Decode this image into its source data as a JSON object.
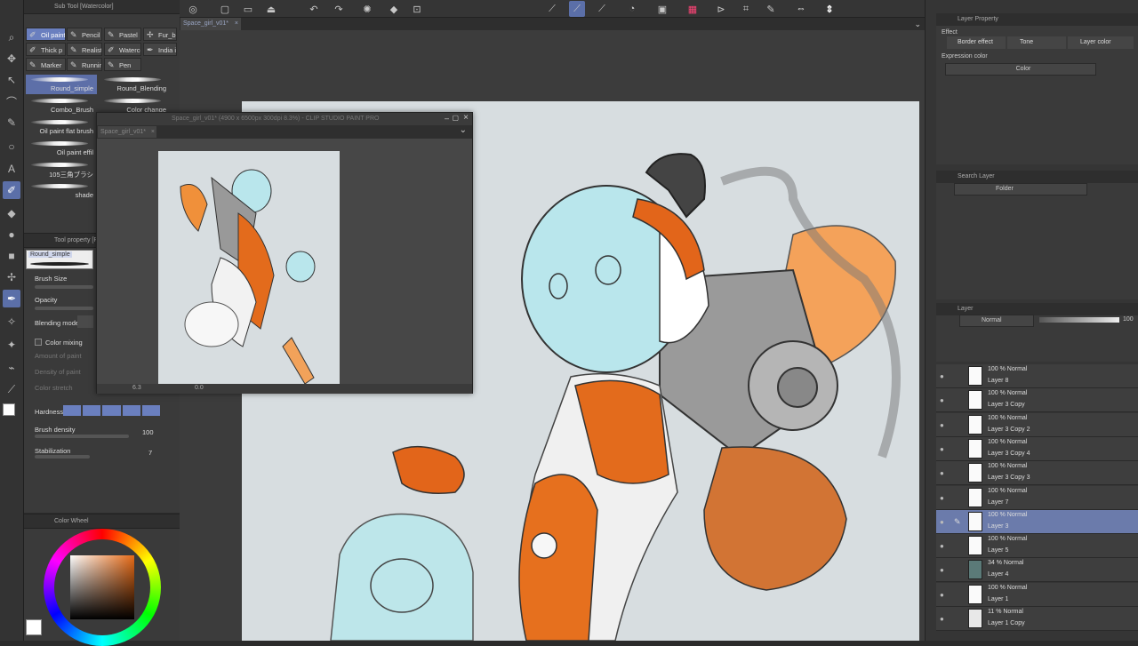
{
  "document_tab": "Space_girl_v01*",
  "subview": {
    "title": "Space_girl_v01* (4900 x 6500px 300dpi 8.3%) - CLIP STUDIO PAINT PRO",
    "tab": "Space_girl_v01*",
    "zoom": "6.3",
    "angle": "0.0"
  },
  "sub_tool": {
    "title": "Sub Tool [Watercolor]",
    "groups": [
      {
        "label": "Oil paint",
        "active": true
      },
      {
        "label": "Pencil"
      },
      {
        "label": "Pastel"
      },
      {
        "label": "Fur_br"
      },
      {
        "label": "Thick p"
      },
      {
        "label": "Realist"
      },
      {
        "label": "Watercolor"
      },
      {
        "label": "India ink"
      },
      {
        "label": "Marker"
      },
      {
        "label": "Running"
      },
      {
        "label": "Pen"
      }
    ],
    "brushes": [
      {
        "label": "Round_simple",
        "active": true
      },
      {
        "label": "Round_Blending"
      },
      {
        "label": "Combo_Brush"
      },
      {
        "label": "Color change"
      },
      {
        "label": "Oil paint flat brush"
      },
      {
        "label": "Oil paint effil"
      },
      {
        "label": "105三角ブラシ"
      },
      {
        "label": "shade"
      }
    ]
  },
  "tool_property": {
    "title": "Tool property [R",
    "preview": "Round_simple",
    "brush_size": "Brush Size",
    "opacity": "Opacity",
    "blending_mode": "Blending mode",
    "color_mixing": "Color mixing",
    "amount_of_paint": "Amount of paint",
    "density_of_paint": "Density of paint",
    "color_stretch": "Color stretch",
    "hardness": "Hardness",
    "brush_density": "Brush density",
    "brush_density_value": "100",
    "stabilization": "Stabilization",
    "stabilization_value": "7"
  },
  "color_wheel": {
    "title": "Color Wheel",
    "main_color": "#ffffff",
    "sub_color": "#000000",
    "square_hue": "#e66a16"
  },
  "layer_property": {
    "title": "Layer Property",
    "effect_label": "Effect",
    "border_effect": "Border effect",
    "tone": "Tone",
    "layer_color": "Layer color",
    "expression_color_label": "Expression color",
    "expression_color_value": "Color"
  },
  "search_layer": {
    "title": "Search Layer",
    "filter": "Folder"
  },
  "layer_panel": {
    "title": "Layer",
    "blend_mode": "Normal",
    "opacity": "100",
    "layers": [
      {
        "mode": "100 % Normal",
        "name": "Layer 8",
        "thumb": "#fafafa"
      },
      {
        "mode": "100 % Normal",
        "name": "Layer 3 Copy",
        "thumb": "#fafafa"
      },
      {
        "mode": "100 % Normal",
        "name": "Layer 3 Copy 2",
        "thumb": "#fafafa"
      },
      {
        "mode": "100 % Normal",
        "name": "Layer 3 Copy 4",
        "thumb": "#fafafa"
      },
      {
        "mode": "100 % Normal",
        "name": "Layer 3 Copy 3",
        "thumb": "#fafafa"
      },
      {
        "mode": "100 % Normal",
        "name": "Layer 7",
        "thumb": "#fafafa"
      },
      {
        "mode": "100 % Normal",
        "name": "Layer 3",
        "thumb": "#fafafa",
        "active": true
      },
      {
        "mode": "100 % Normal",
        "name": "Layer 5",
        "thumb": "#fafafa"
      },
      {
        "mode": "34 % Normal",
        "name": "Layer 4",
        "thumb": "#5b7a78"
      },
      {
        "mode": "100 % Normal",
        "name": "Layer 1",
        "thumb": "#fafafa"
      },
      {
        "mode": "11 % Normal",
        "name": "Layer 1 Copy",
        "thumb": "#e8e8e8"
      }
    ]
  }
}
